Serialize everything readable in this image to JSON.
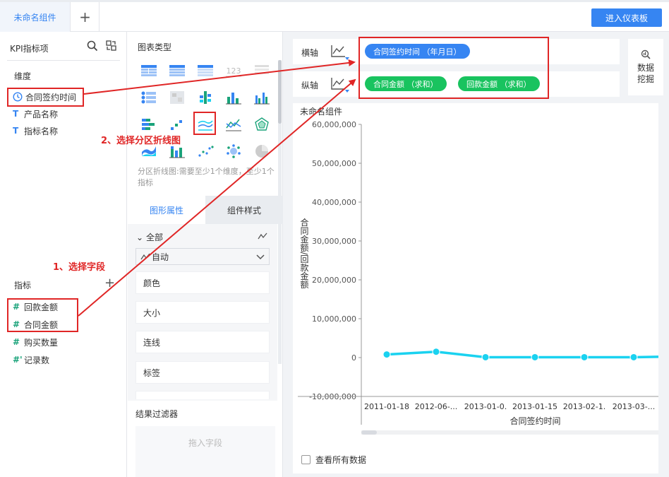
{
  "header": {
    "tab_label": "未命名组件",
    "add_tab": "+",
    "enter_dashboard": "进入仪表板"
  },
  "left_panel": {
    "title": "KPI指标项",
    "dimension_title": "维度",
    "dimensions": [
      {
        "type": "date",
        "label": "合同签约时间"
      },
      {
        "type": "text",
        "label": "产品名称"
      },
      {
        "type": "text",
        "label": "指标名称"
      }
    ],
    "metric_title": "指标",
    "metric_add": "+",
    "metrics": [
      {
        "type": "#",
        "label": "回款金额"
      },
      {
        "type": "#",
        "label": "合同金额"
      },
      {
        "type": "#",
        "label": "购买数量"
      },
      {
        "type": "#'",
        "label": "记录数"
      }
    ]
  },
  "chart_type_panel": {
    "title": "图表类型",
    "icon_text_123": "123",
    "description": "分区折线图:需要至少1个维度，至少1个指标",
    "tabs": [
      "图形属性",
      "组件样式"
    ],
    "all_label": "全部",
    "auto_label": "自动",
    "properties": [
      "颜色",
      "大小",
      "连线",
      "标签"
    ],
    "filter_title": "结果过滤器",
    "filter_placeholder": "拖入字段"
  },
  "axes": {
    "x_label": "横轴",
    "y_label": "纵轴",
    "x_fields": [
      "合同签约时间 （年月日）"
    ],
    "y_fields": [
      "合同金额 （求和）",
      "回款金额 （求和）"
    ]
  },
  "mining": {
    "line1": "数据",
    "line2": "挖掘"
  },
  "chart_panel": {
    "title": "未命名组件",
    "view_all": "查看所有数据"
  },
  "annotations": {
    "step1": "1、选择字段",
    "step2": "2、选择分区折线图"
  },
  "colors": {
    "accent": "#3685f2",
    "pill_green": "#19c35f",
    "series": "#1ad2f0",
    "annotation": "#e02626"
  },
  "chart_data": {
    "type": "line",
    "categories": [
      "2011-01-18",
      "2012-06-...",
      "2013-01-0.",
      "2013-01-15",
      "2013-02-1.",
      "2013-03-..."
    ],
    "series": [
      {
        "values": [
          800000,
          1500000,
          100000,
          100000,
          100000,
          100000
        ]
      }
    ],
    "ytick_labels": [
      "60,000,000",
      "50,000,000",
      "40,000,000",
      "30,000,000",
      "20,000,000",
      "10,000,000",
      "0",
      "-10,000,000"
    ],
    "yticks": [
      60000000,
      50000000,
      40000000,
      30000000,
      20000000,
      10000000,
      0,
      -10000000
    ],
    "ylim": [
      -10000000,
      60000000
    ],
    "xlabel": "合同签约时间",
    "ylabel": "合同金额/回款金额"
  }
}
